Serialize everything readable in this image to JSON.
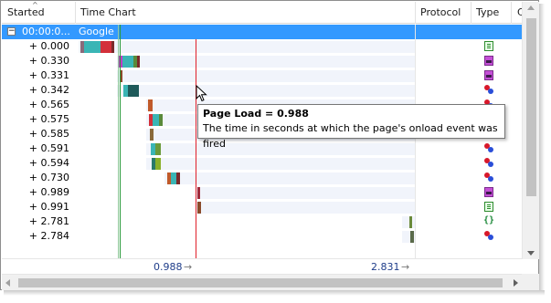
{
  "columns": {
    "started": "Started",
    "time_chart": "Time Chart",
    "protocol": "Protocol",
    "type": "Type",
    "extra": "C"
  },
  "group_row": {
    "expander": "−",
    "started": "00:00:0...",
    "name": "Google"
  },
  "rows": [
    {
      "started": "+ 0.000",
      "type_icon": "html-document-icon"
    },
    {
      "started": "+ 0.330",
      "type_icon": "stylesheet-icon"
    },
    {
      "started": "+ 0.331",
      "type_icon": "stylesheet-icon"
    },
    {
      "started": "+ 0.342",
      "type_icon": "image-icon"
    },
    {
      "started": "+ 0.565",
      "type_icon": "image-icon"
    },
    {
      "started": "+ 0.575",
      "type_icon": "image-icon"
    },
    {
      "started": "+ 0.585",
      "type_icon": "html-document-icon"
    },
    {
      "started": "+ 0.591",
      "type_icon": "image-icon"
    },
    {
      "started": "+ 0.594",
      "type_icon": "image-icon"
    },
    {
      "started": "+ 0.730",
      "type_icon": "image-icon"
    },
    {
      "started": "+ 0.989",
      "type_icon": "stylesheet-icon"
    },
    {
      "started": "+ 0.991",
      "type_icon": "html-document-icon"
    },
    {
      "started": "+ 2.781",
      "type_icon": "json-icon"
    },
    {
      "started": "+ 2.784",
      "type_icon": "image-icon"
    }
  ],
  "footer": {
    "page_load_marker": "0.988",
    "end_marker": "2.831",
    "arrow": "→"
  },
  "tooltip": {
    "title": "Page Load = 0.988",
    "body": "The time in seconds at which the page's onload event was fired"
  },
  "colors": {
    "selection": "#3399ff",
    "page_load_line": "#e0202a",
    "dom_line": "#2a9a3a"
  }
}
